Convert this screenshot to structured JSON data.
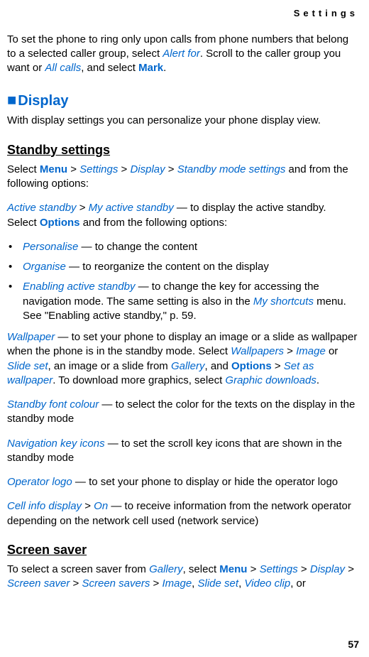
{
  "header": {
    "title": "Settings"
  },
  "intro": {
    "p1a": "To set the phone to ring only upon calls from phone numbers that belong to a selected caller group, select ",
    "p1_alertfor": "Alert for",
    "p1b": ". Scroll to the caller group you want or ",
    "p1_allcalls": "All calls",
    "p1c": ", and select ",
    "p1_mark": "Mark",
    "p1d": "."
  },
  "display": {
    "marker": "■",
    "title": "Display",
    "intro": "With display settings you can personalize your phone display view."
  },
  "standby": {
    "heading": "Standby settings",
    "p1a": "Select ",
    "menu": "Menu",
    "gt": " > ",
    "settings": "Settings",
    "display": "Display",
    "sms": "Standby mode settings",
    "p1b": " and from the following options:",
    "p2a": "Active standby",
    "p2b": "My active standby",
    "p2c": " — to display the active standby. Select ",
    "options": "Options",
    "p2d": " and from the following options:",
    "bullet1a": "Personalise",
    "bullet1b": " — to change the content",
    "bullet2a": "Organise",
    "bullet2b": " — to reorganize the content on the display",
    "bullet3a": "Enabling active standby",
    "bullet3b": " — to change the key for accessing the navigation mode. The same setting is also in the ",
    "bullet3c": "My shortcuts",
    "bullet3d": " menu. See \"Enabling active standby,\" p. 59.",
    "wallpaper_a": "Wallpaper",
    "wallpaper_b": " — to set your phone to display an image or a slide as wallpaper when the phone is in the standby mode. Select ",
    "wallpapers": "Wallpapers",
    "image": "Image",
    "or": " or ",
    "slideset": "Slide set",
    "wallpaper_c": ", an image or a slide from ",
    "gallery": "Gallery",
    "and": ", and ",
    "setaswallpaper": "Set as wallpaper",
    "wallpaper_d": ". To download more graphics, select ",
    "graphicdownloads": "Graphic downloads",
    "period": ".",
    "font_a": "Standby font colour",
    "font_b": " — to select the color for the texts on the display in the standby mode",
    "nav_a": "Navigation key icons",
    "nav_b": " — to set the scroll key icons that are shown in the standby mode",
    "oplogo_a": "Operator logo",
    "oplogo_b": " — to set your phone to display or hide the operator logo",
    "cell_a": "Cell info display",
    "cell_on": "On",
    "cell_b": " — to receive information from the network operator depending on the network cell used (network service)"
  },
  "screensaver": {
    "heading": "Screen saver",
    "p1a": "To select a screen saver from ",
    "gallery": "Gallery",
    "p1b": ", select ",
    "menu": "Menu",
    "gt": " > ",
    "settings": "Settings",
    "display": "Display",
    "ss": "Screen saver",
    "sss": "Screen savers",
    "image": "Image",
    "comma": ", ",
    "slideset": "Slide set",
    "videoclip": "Video clip",
    "p1c": ", or "
  },
  "page": "57"
}
